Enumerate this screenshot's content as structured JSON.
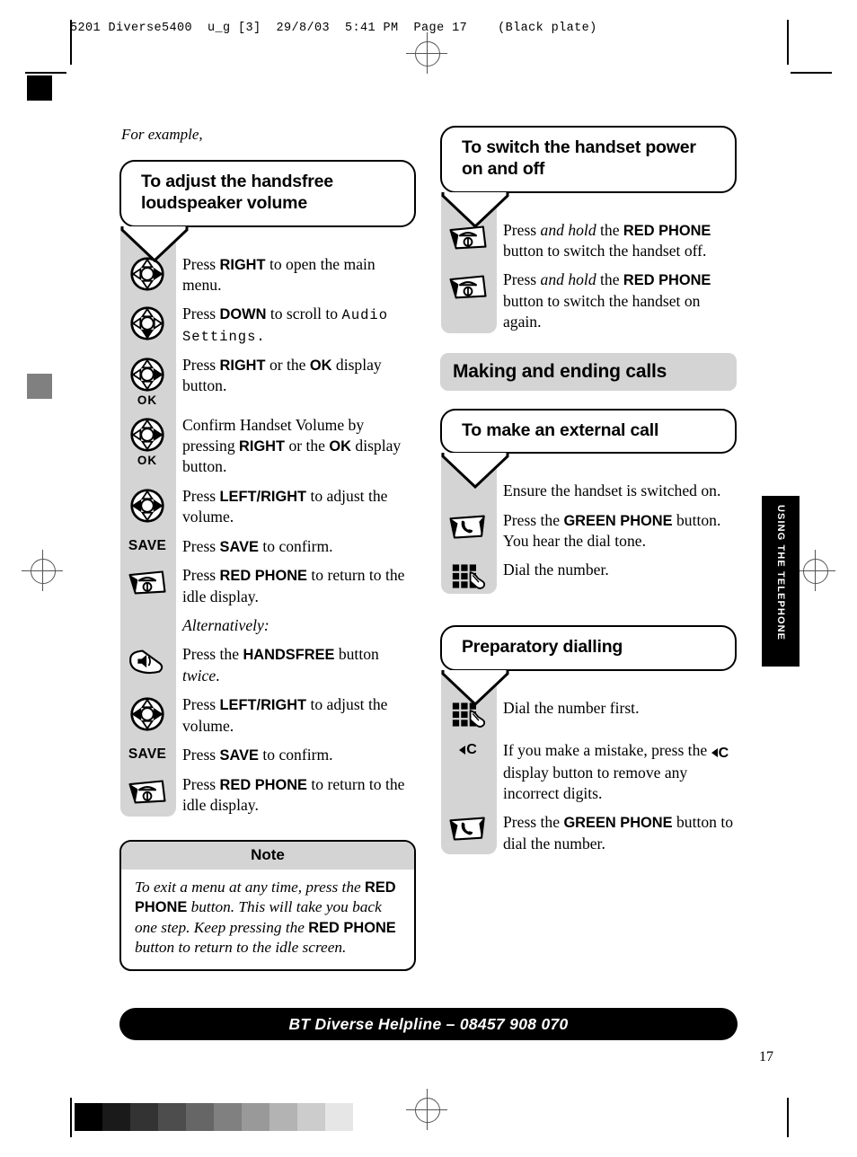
{
  "print": {
    "header_line": "5201 Diverse5400  u_g [3]  29/8/03  5:41 PM  Page 17    (Black plate)",
    "greyscale_bar": [
      "#000000",
      "#1a1a1a",
      "#333333",
      "#4d4d4d",
      "#666666",
      "#808080",
      "#999999",
      "#b3b3b3",
      "#cccccc",
      "#e6e6e6"
    ],
    "reg_square_top_color": "#000000",
    "reg_square_mid_color": "#808080"
  },
  "side_tab": {
    "label": "USING THE TELEPHONE"
  },
  "page_number": "17",
  "footer": {
    "helpline": "BT Diverse Helpline – 08457 908 070"
  },
  "left_column": {
    "intro": "For example,",
    "bubble_title": "To adjust the handsfree loudspeaker volume",
    "steps": [
      {
        "icon": "dpad-right-icon",
        "sublabel": "",
        "text_html": "Press <b>RIGHT</b> to open the main menu."
      },
      {
        "icon": "dpad-down-icon",
        "sublabel": "",
        "text_html": "Press <b>DOWN</b> to scroll to <span class=\"lcd\">Audio Settings.</span>"
      },
      {
        "icon": "dpad-right-icon",
        "sublabel": "OK",
        "text_html": "Press <b>RIGHT</b> or the <b>OK</b> display button."
      },
      {
        "icon": "dpad-right-icon",
        "sublabel": "OK",
        "text_html": "Confirm Handset Volume by pressing <b>RIGHT</b> or the <b>OK</b> display button."
      },
      {
        "icon": "dpad-leftright-icon",
        "sublabel": "",
        "text_html": "Press <b>LEFT/RIGHT</b> to adjust the volume."
      },
      {
        "icon": "save-label-icon",
        "sublabel": "SAVE",
        "text_html": "Press <b>SAVE</b> to confirm."
      },
      {
        "icon": "red-phone-icon",
        "sublabel": "",
        "text_html": "Press <b>RED PHONE</b> to return to the idle display."
      },
      {
        "icon": "none",
        "sublabel": "",
        "text_html": "<i>Alternatively:</i>"
      },
      {
        "icon": "handsfree-icon",
        "sublabel": "",
        "text_html": "Press the <b>HANDSFREE</b> button <i>twice</i>."
      },
      {
        "icon": "dpad-leftright-icon",
        "sublabel": "",
        "text_html": "Press <b>LEFT/RIGHT</b> to adjust the volume."
      },
      {
        "icon": "save-label-icon",
        "sublabel": "SAVE",
        "text_html": "Press <b>SAVE</b> to confirm."
      },
      {
        "icon": "red-phone-icon",
        "sublabel": "",
        "text_html": "Press <b>RED PHONE</b> to return to the idle display."
      }
    ],
    "note": {
      "heading": "Note",
      "body_html": "To exit a menu at any time, press the <b>RED PHONE</b> button. This will take you back one step. Keep pressing the <b>RED PHONE</b> button to return to the idle screen."
    }
  },
  "right_column": {
    "power_bubble_title": "To switch the handset power on and off",
    "power_steps": [
      {
        "icon": "red-phone-icon",
        "sublabel": "",
        "text_html": "Press <i>and hold</i> the <b>RED PHONE</b> button to switch the handset off."
      },
      {
        "icon": "red-phone-icon",
        "sublabel": "",
        "text_html": "Press <i>and hold</i> the <b>RED PHONE</b> button to switch the handset on again."
      }
    ],
    "section_title": "Making and ending calls",
    "external_bubble_title": "To make an external call",
    "external_steps": [
      {
        "icon": "none",
        "sublabel": "",
        "text_html": "Ensure the handset is switched on."
      },
      {
        "icon": "green-phone-icon",
        "sublabel": "",
        "text_html": "Press the <b>GREEN PHONE</b> button. You hear the dial tone."
      },
      {
        "icon": "keypad-icon",
        "sublabel": "",
        "text_html": "Dial the number."
      }
    ],
    "prep_bubble_title": "Preparatory dialling",
    "prep_steps": [
      {
        "icon": "keypad-icon",
        "sublabel": "",
        "text_html": "Dial the number first."
      },
      {
        "icon": "clear-c-icon",
        "sublabel": "",
        "text_html": "If you make a mistake, press the <span class=\"cbtn\" style=\"display:inline-flex;vertical-align:-2px\"><span class=\"tri\"></span>C</span> display button to remove any incorrect digits."
      },
      {
        "icon": "green-phone-icon",
        "sublabel": "",
        "text_html": "Press the <b>GREEN PHONE</b> button to dial the number."
      }
    ]
  }
}
